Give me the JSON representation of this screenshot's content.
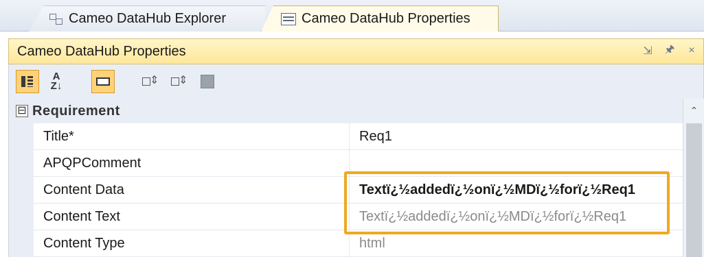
{
  "tabs": [
    {
      "label": "Cameo DataHub Explorer",
      "icon": "explorer-icon",
      "active": false
    },
    {
      "label": "Cameo DataHub Properties",
      "icon": "properties-icon",
      "active": true
    }
  ],
  "panel": {
    "title": "Cameo DataHub Properties",
    "controls": {
      "restore": "⇲",
      "pin": "🖈",
      "close": "×"
    }
  },
  "toolbar": {
    "az_label": "A\nZ↓"
  },
  "category": {
    "toggle": "⊟",
    "label": "Requirement"
  },
  "properties": [
    {
      "name": "Title*",
      "value": "Req1",
      "style": "normal"
    },
    {
      "name": "APQPComment",
      "value": "",
      "style": "normal"
    },
    {
      "name": "Content Data",
      "value": "Textï¿½addedï¿½onï¿½MDï¿½forï¿½Req1",
      "style": "bold"
    },
    {
      "name": "Content Text",
      "value": "Textï¿½addedï¿½onï¿½MDï¿½forï¿½Req1",
      "style": "gray"
    },
    {
      "name": "Content Type",
      "value": "html",
      "style": "gray"
    }
  ],
  "colors": {
    "accent": "#f0a81e",
    "header": "#ffe79a",
    "toolbar": "#e9eef6"
  }
}
